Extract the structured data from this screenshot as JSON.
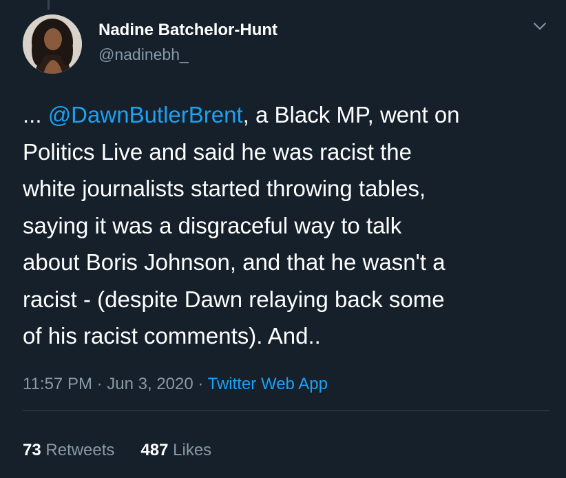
{
  "author": {
    "display_name": "Nadine Batchelor-Hunt",
    "handle": "@nadinebh_",
    "avatar_icon": "profile-photo"
  },
  "menu": {
    "icon": "chevron-down-icon"
  },
  "tweet": {
    "lines": [
      {
        "prefix": "... ",
        "mention": "@DawnButlerBrent",
        "rest": ", a Black MP, went on"
      },
      {
        "text": "Politics Live and said he was racist the"
      },
      {
        "text": "white journalists started throwing tables,"
      },
      {
        "text": "saying it was a disgraceful way to talk"
      },
      {
        "text": "about Boris Johnson, and that he wasn't a"
      },
      {
        "text": "racist - (despite Dawn relaying back some"
      },
      {
        "text": "of his racist comments). And.."
      }
    ]
  },
  "meta": {
    "time": "11:57 PM",
    "separator": " · ",
    "date": "Jun 3, 2020",
    "source": "Twitter Web App"
  },
  "stats": {
    "retweets_count": "73",
    "retweets_label": "Retweets",
    "likes_count": "487",
    "likes_label": "Likes"
  },
  "colors": {
    "background": "#15202b",
    "text": "#ffffff",
    "secondary": "#8899a6",
    "accent": "#1da1f2",
    "divider": "#38444d"
  }
}
